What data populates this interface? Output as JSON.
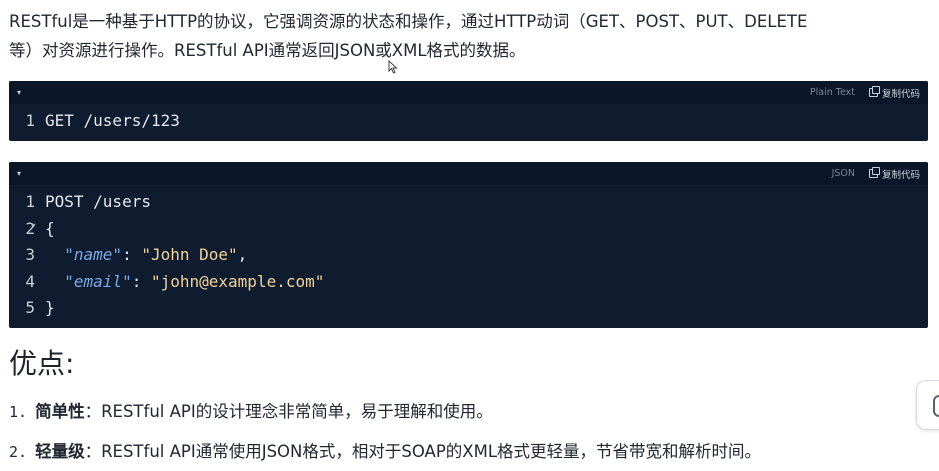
{
  "intro": {
    "line1": "RESTful是一种基于HTTP的协议，它强调资源的状态和操作，通过HTTP动词（GET、POST、PUT、DELETE",
    "line2": "等）对资源进行操作。RESTful API通常返回JSON或XML格式的数据。"
  },
  "code_blocks": [
    {
      "toggle": "▾",
      "language": "Plain Text",
      "copy_label": "复制代码",
      "lines": [
        {
          "num": "1",
          "text": "GET /users/123"
        }
      ]
    },
    {
      "toggle": "▾",
      "language": "JSON",
      "copy_label": "复制代码",
      "lines": [
        {
          "num": "1",
          "text": "POST /users"
        },
        {
          "num": "2",
          "text": "{"
        },
        {
          "num": "3",
          "key": "\"name\"",
          "sep": ": ",
          "value": "\"John Doe\"",
          "tail": ","
        },
        {
          "num": "4",
          "key": "\"email\"",
          "sep": ": ",
          "value": "\"john@example.com\"",
          "tail": ""
        },
        {
          "num": "5",
          "text": "}"
        }
      ]
    }
  ],
  "section": {
    "title": "优点:"
  },
  "advantages": [
    {
      "num": "1.",
      "term": "简单性",
      "desc": "：RESTful API的设计理念非常简单，易于理解和使用。"
    },
    {
      "num": "2.",
      "term": "轻量级",
      "desc": "：RESTful API通常使用JSON格式，相对于SOAP的XML格式更轻量，节省带宽和解析时间。"
    }
  ],
  "colors": {
    "code_bg": "#0f1b2e",
    "code_header_bg": "#0b1628",
    "json_key": "#7aa9e6",
    "json_string": "#f2d49b"
  },
  "icons": {
    "collapse": "chevron-down-icon",
    "copy": "copy-icon",
    "cursor": "mouse-cursor-icon",
    "side_tab": "side-panel-icon"
  }
}
